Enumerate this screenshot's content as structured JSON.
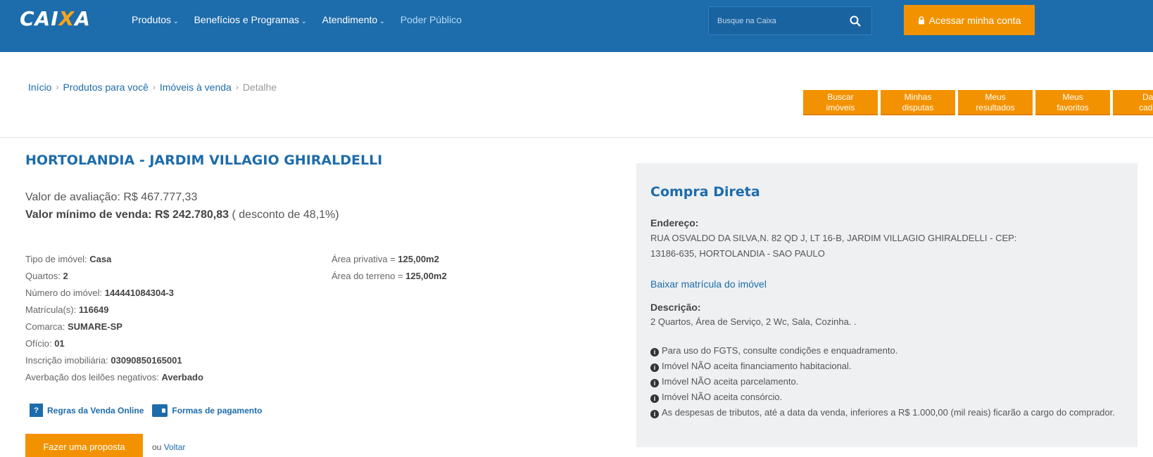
{
  "header": {
    "logo": {
      "left": "CAI",
      "x": "X",
      "right": "A"
    },
    "nav": [
      {
        "label": "Produtos"
      },
      {
        "label": "Benefícios e Programas"
      },
      {
        "label": "Atendimento"
      },
      {
        "label": "Poder Público"
      }
    ],
    "search": {
      "placeholder": "Busque na Caixa"
    },
    "account_button": "Acessar minha conta"
  },
  "breadcrumb": {
    "items": [
      "Início",
      "Produtos para você",
      "Imóveis à venda"
    ],
    "current": "Detalhe"
  },
  "quick_buttons": [
    "Buscar\nimóveis",
    "Minhas\ndisputas",
    "Meus\nresultados",
    "Meus\nfavoritos",
    "Dad\ncadas"
  ],
  "property": {
    "title": "HORTOLANDIA - JARDIM VILLAGIO GHIRALDELLI",
    "valuation_label": "Valor de avaliação:",
    "valuation_value": "R$ 467.777,33",
    "min_label": "Valor mínimo de venda:",
    "min_value": "R$ 242.780,83",
    "discount": "( desconto de 48,1%)",
    "details": [
      {
        "label": "Tipo de imóvel: ",
        "value": "Casa"
      },
      {
        "label": "Quartos: ",
        "value": "2"
      },
      {
        "label": "Número do imóvel: ",
        "value": "144441084304-3"
      },
      {
        "label": "Matrícula(s): ",
        "value": "116649"
      },
      {
        "label": "Comarca: ",
        "value": "SUMARE-SP"
      },
      {
        "label": "Ofício: ",
        "value": "01"
      },
      {
        "label": "Inscrição imobiliária: ",
        "value": "03090850165001"
      },
      {
        "label": "Averbação dos leilões negativos: ",
        "value": "Averbado"
      }
    ],
    "areas": [
      {
        "label": "Área privativa = ",
        "value": "125,00m2"
      },
      {
        "label": "Área do terreno = ",
        "value": "125,00m2"
      }
    ],
    "links": {
      "rules": "Regras da Venda Online",
      "payment": "Formas de pagamento"
    },
    "proposal_button": "Fazer uma proposta",
    "back_prefix": "ou ",
    "back_link": "Voltar"
  },
  "panel": {
    "title": "Compra Direta",
    "address_label": "Endereço:",
    "address_line1": "RUA OSVALDO DA SILVA,N. 82 QD J, LT 16-B, JARDIM VILLAGIO GHIRALDELLI - CEP:",
    "address_line2": "13186-635, HORTOLANDIA - SAO PAULO",
    "download_link": "Baixar matrícula do imóvel",
    "description_label": "Descrição:",
    "description": "2 Quartos, Área de Serviço, 2 Wc, Sala, Cozinha. .",
    "notes": [
      "Para uso do FGTS, consulte condições e enquadramento.",
      "Imóvel NÃO aceita financiamento habitacional.",
      "Imóvel NÃO aceita parcelamento.",
      "Imóvel NÃO aceita consórcio.",
      "As despesas de tributos, até a data da venda, inferiores a R$ 1.000,00 (mil reais) ficarão a cargo do comprador."
    ]
  },
  "colors": {
    "header_blue": "#1d6cab",
    "accent_orange": "#f39200",
    "panel_gray": "#eef0f2"
  },
  "icons": [
    "search-icon",
    "lock-icon",
    "chevron-down-icon",
    "help-icon",
    "wallet-icon",
    "info-icon"
  ]
}
